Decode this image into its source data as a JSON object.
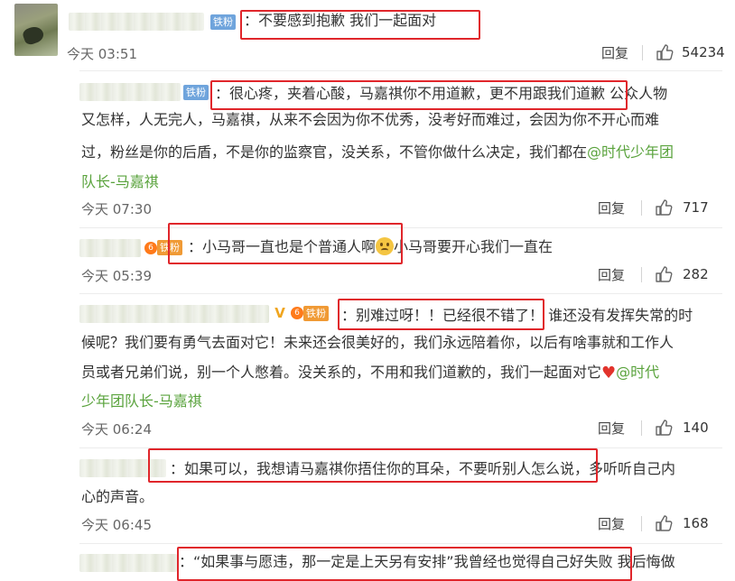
{
  "main_comment": {
    "badge": "铁粉",
    "text": "：不要感到抱歉 我们一起面对",
    "time": "今天 03:51",
    "reply_label": "回复",
    "likes": "54234"
  },
  "replies": [
    {
      "badge": "铁粉",
      "lines": [
        "：很心疼，夹着心酸，马嘉祺你不用道歉，更不用跟我们道歉  公众人物",
        "又怎样，人无完人，马嘉祺，从来不会因为你不优秀，没考好而难过，会因为你不开心而难",
        "过，粉丝是你的后盾，不是你的监察官，没关系，不管你做什么决定，我们都在"
      ],
      "link_a": "@时代少年团",
      "link_b": "队长-马嘉祺",
      "time": "今天 07:30",
      "reply_label": "回复",
      "likes": "717"
    },
    {
      "badge": "铁粉",
      "text_a": "：小马哥一直也是个普通人啊",
      "text_b": "小马哥要开心我们一直在",
      "time": "今天 05:39",
      "reply_label": "回复",
      "likes": "282"
    },
    {
      "badge": "铁粉",
      "line1": "：别难过呀！！已经很不错了！ 谁还没有发挥失常的时",
      "line2": "候呢？我们要有勇气去面对它！未来还会很美好的，我们永远陪着你，以后有啥事就和工作人",
      "line3": "员或者兄弟们说，别一个人憋着。没关系的，不用和我们道歉的，我们一起面对它",
      "link_a": "@时代",
      "link_b": "少年团队长-马嘉祺",
      "time": "今天 06:24",
      "reply_label": "回复",
      "likes": "140"
    },
    {
      "line1": "：如果可以，我想请马嘉祺你捂住你的耳朵，不要听别人怎么说，多听听自己内",
      "line2": "心的声音。",
      "time": "今天 06:45",
      "reply_label": "回复",
      "likes": "168"
    },
    {
      "line1": "：“如果事与愿违，那一定是上天另有安排”我曾经也觉得自己好失败   我后悔做"
    }
  ],
  "colors": {
    "link": "#5aa33d",
    "highlight": "#e0262b",
    "badge_blue": "#6fa4dc",
    "badge_orange": "#f09a35"
  },
  "icons": [
    "thumb-up-icon",
    "v-verified-icon",
    "emoji-icon",
    "heart-icon"
  ]
}
